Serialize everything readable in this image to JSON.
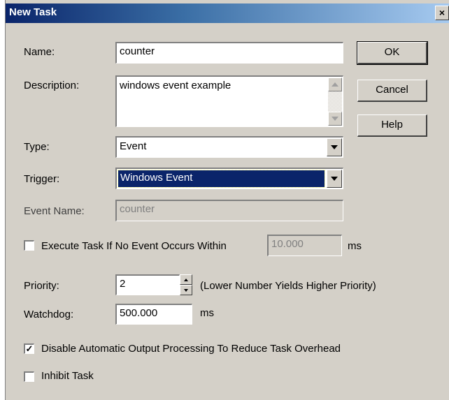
{
  "window": {
    "title": "New Task",
    "close_glyph": "×"
  },
  "buttons": {
    "ok": "OK",
    "cancel": "Cancel",
    "help": "Help"
  },
  "fields": {
    "name_label": "Name:",
    "name_value": "counter",
    "description_label": "Description:",
    "description_value": "windows event example",
    "type_label": "Type:",
    "type_value": "Event",
    "trigger_label": "Trigger:",
    "trigger_value": "Windows Event",
    "event_name_label": "Event Name:",
    "event_name_value": "counter"
  },
  "execute_timeout": {
    "label": "Execute Task If No Event Occurs Within",
    "value": "10.000",
    "unit": "ms",
    "checked": false
  },
  "priority": {
    "label": "Priority:",
    "value": "2",
    "hint": "(Lower Number Yields Higher Priority)"
  },
  "watchdog": {
    "label": "Watchdog:",
    "value": "500.000",
    "unit": "ms"
  },
  "disable_output": {
    "label": "Disable Automatic Output Processing To Reduce Task Overhead",
    "checked": true,
    "check_glyph": "✓"
  },
  "inhibit": {
    "label": "Inhibit Task",
    "checked": false
  },
  "icons": [
    "close-icon",
    "dropdown-arrow-icon",
    "scroll-up-icon",
    "scroll-down-icon",
    "spin-up-icon",
    "spin-down-icon",
    "checkmark-icon"
  ]
}
